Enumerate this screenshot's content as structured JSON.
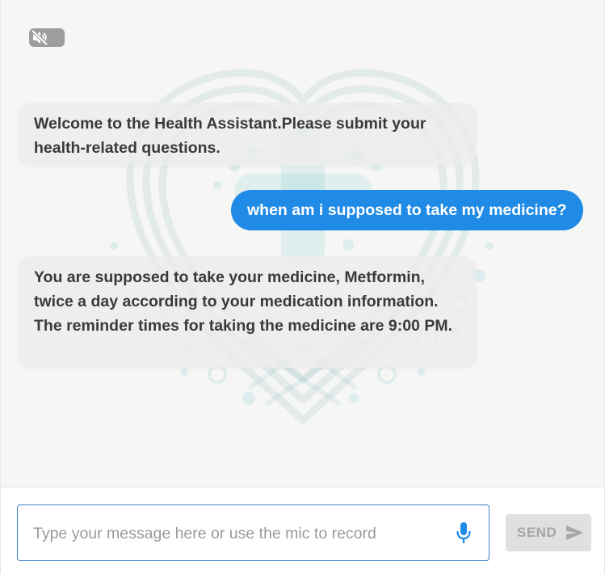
{
  "colors": {
    "accent": "#1f8be6",
    "user_bubble": "#1f8be6",
    "bot_bubble": "#ececeb",
    "background": "#f6f6f5",
    "input_border": "#3b82c4",
    "send_disabled": "#e0e0e0",
    "watermark": "#5aa0a8"
  },
  "header": {
    "tts_toggle_icon": "speaker-muted-icon"
  },
  "messages": [
    {
      "role": "bot",
      "text": "Welcome to the Health Assistant.Please submit your health-related questions."
    },
    {
      "role": "user",
      "text": "when am i supposed to take my medicine?"
    },
    {
      "role": "bot",
      "text": "You are supposed to take your medicine, Metformin, twice a day according to your medication information. The reminder times for taking the medicine are 9:00 PM."
    }
  ],
  "composer": {
    "placeholder": "Type your message here or use the mic to record",
    "value": "",
    "mic_icon": "microphone-icon",
    "send_label": "SEND",
    "send_icon": "send-arrow-icon"
  },
  "background_logo": "heart-cross-icon"
}
